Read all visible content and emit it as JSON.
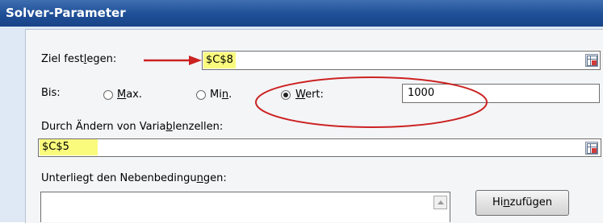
{
  "window": {
    "title": "Solver-Parameter"
  },
  "objective": {
    "label_pre": "Ziel fest",
    "label_acc": "l",
    "label_post": "egen:",
    "value": "$C$8"
  },
  "target": {
    "label": "Bis:",
    "options": [
      {
        "acc": "M",
        "rest": "ax.",
        "selected": false
      },
      {
        "pre": "Mi",
        "acc": "n",
        "rest": ".",
        "selected": false
      },
      {
        "acc": "W",
        "rest": "ert:",
        "selected": true
      }
    ],
    "value": "1000"
  },
  "variables": {
    "label_pre": "Durch Ändern von Varia",
    "label_acc": "b",
    "label_post": "lenzellen:",
    "value": "$C$5"
  },
  "constraints": {
    "label_pre": "Unterliegt den Nebenbedingu",
    "label_acc": "n",
    "label_post": "gen:",
    "add_button": {
      "pre": "Hi",
      "acc": "n",
      "post": "zufügen"
    }
  },
  "colors": {
    "titlebar": "#1e4f97",
    "highlight": "#fafa7d",
    "annotation": "#cc2222"
  },
  "icons": [
    "cell-picker-icon",
    "annotation-arrow",
    "annotation-ellipse",
    "scroll-up-arrow-icon"
  ]
}
